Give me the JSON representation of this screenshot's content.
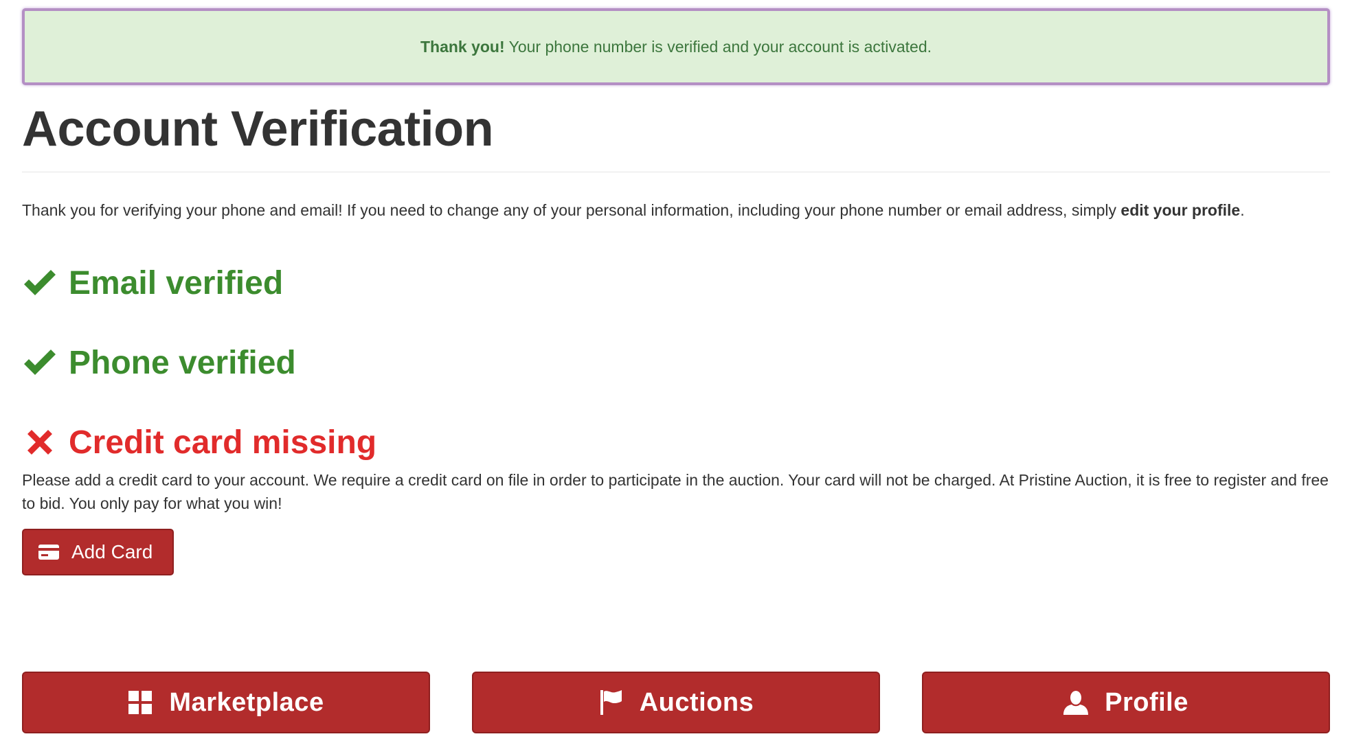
{
  "alert": {
    "strong": "Thank you!",
    "text": " Your phone number is verified and your account is activated."
  },
  "page": {
    "title": "Account Verification",
    "intro": "Thank you for verifying your phone and email! If you need to change any of your personal information, including your phone number or email address, simply ",
    "intro_link": "edit your profile",
    "intro_end": "."
  },
  "status": {
    "email": {
      "label": "Email verified",
      "state": "ok",
      "icon": "checkmark-icon"
    },
    "phone": {
      "label": "Phone verified",
      "state": "ok",
      "icon": "checkmark-icon"
    },
    "card": {
      "label": "Credit card missing",
      "state": "missing",
      "icon": "x-mark-icon"
    }
  },
  "card_note": "Please add a credit card to your account. We require a credit card on file in order to participate in the auction. Your card will not be charged. At Pristine Auction, it is free to register and free to bid. You only pay for what you win!",
  "add_card": {
    "label": "Add Card",
    "icon": "credit-card-icon"
  },
  "nav": [
    {
      "label": "Marketplace",
      "icon": "grid-icon"
    },
    {
      "label": "Auctions",
      "icon": "flag-icon"
    },
    {
      "label": "Profile",
      "icon": "user-icon"
    }
  ],
  "colors": {
    "success": "#3c8c2e",
    "danger": "#e12b2b",
    "button": "#b22c2c",
    "alert_bg": "#dff0d8",
    "alert_text": "#3c763d"
  }
}
